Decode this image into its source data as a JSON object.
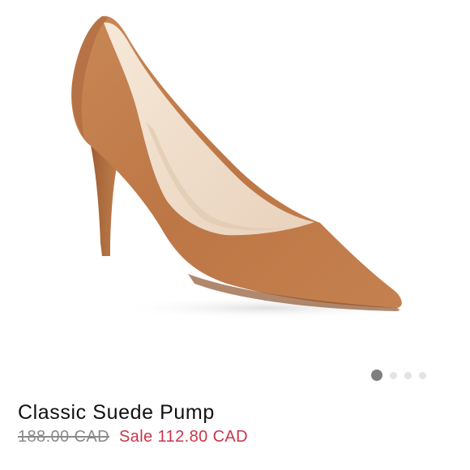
{
  "product": {
    "name": "Classic Suede Pump",
    "original_price": "188.00 CAD",
    "sale_price": "Sale 112.80 CAD",
    "image_alt_icon": "suede-pump-shoe-image",
    "colors": {
      "suede": "#c07a4a",
      "lining": "#efdcc8",
      "sale": "#c8364a",
      "strikethrough": "#8a8a8a"
    }
  },
  "carousel": {
    "total": 4,
    "active_index": 0
  }
}
